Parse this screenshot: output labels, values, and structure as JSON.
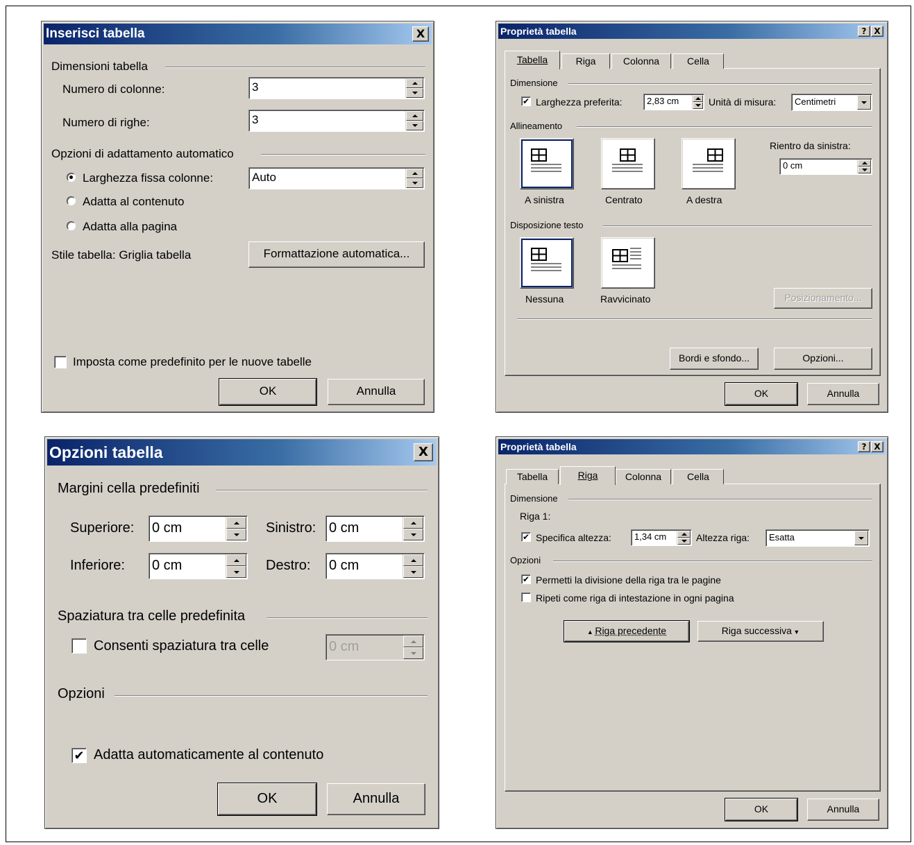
{
  "d1": {
    "title": "Inserisci tabella",
    "close": "X",
    "dim_group": "Dimensioni tabella",
    "cols_label": "Numero di colonne:",
    "cols_value": "3",
    "rows_label": "Numero di righe:",
    "rows_value": "3",
    "autofit_group": "Opzioni di adattamento automatico",
    "fixed_label": "Larghezza fissa colonne:",
    "fixed_value": "Auto",
    "content_label": "Adatta al contenuto",
    "window_label": "Adatta alla pagina",
    "style_label": "Stile tabella:  Griglia tabella",
    "autoformat_button": "Formattazione automatica...",
    "default_label": "Imposta come predefinito per le nuove tabelle",
    "ok": "OK",
    "cancel": "Annulla"
  },
  "d2": {
    "title": "Proprietà tabella",
    "help": "?",
    "close": "X",
    "tabs": [
      "Tabella",
      "Riga",
      "Colonna",
      "Cella"
    ],
    "dim_group": "Dimensione",
    "pref_width_label": "Larghezza preferita:",
    "pref_width_value": "2,83 cm",
    "unit_label": "Unità di misura:",
    "unit_value": "Centimetri",
    "align_group": "Allineamento",
    "align_left": "A sinistra",
    "align_center": "Centrato",
    "align_right": "A destra",
    "indent_label": "Rientro da sinistra:",
    "indent_value": "0 cm",
    "wrap_group": "Disposizione testo",
    "wrap_none": "Nessuna",
    "wrap_around": "Ravvicinato",
    "position_button": "Posizionamento...",
    "borders_button": "Bordi e sfondo...",
    "options_button": "Opzioni...",
    "ok": "OK",
    "cancel": "Annulla"
  },
  "d3": {
    "title": "Opzioni tabella",
    "close": "X",
    "margins_group": "Margini cella predefiniti",
    "top_label": "Superiore:",
    "top_value": "0 cm",
    "left_label": "Sinistro:",
    "left_value": "0 cm",
    "bottom_label": "Inferiore:",
    "bottom_value": "0 cm",
    "right_label": "Destro:",
    "right_value": "0 cm",
    "spacing_group": "Spaziatura tra celle predefinita",
    "allow_spacing_label": "Consenti spaziatura tra celle",
    "spacing_value": "0 cm",
    "options_group": "Opzioni",
    "autoresize_label": "Adatta automaticamente al contenuto",
    "ok": "OK",
    "cancel": "Annulla"
  },
  "d4": {
    "title": "Proprietà tabella",
    "help": "?",
    "close": "X",
    "tabs": [
      "Tabella",
      "Riga",
      "Colonna",
      "Cella"
    ],
    "dim_group": "Dimensione",
    "row_label": "Riga 1:",
    "height_label": "Specifica altezza:",
    "height_value": "1,34 cm",
    "rowheight_label": "Altezza riga:",
    "rowheight_value": "Esatta",
    "options_group": "Opzioni",
    "allow_break_label": "Permetti la divisione della riga tra le pagine",
    "repeat_header_label": "Ripeti come riga di intestazione in ogni pagina",
    "prev_row_button": "Riga precedente",
    "next_row_button": "Riga successiva",
    "ok": "OK",
    "cancel": "Annulla"
  }
}
